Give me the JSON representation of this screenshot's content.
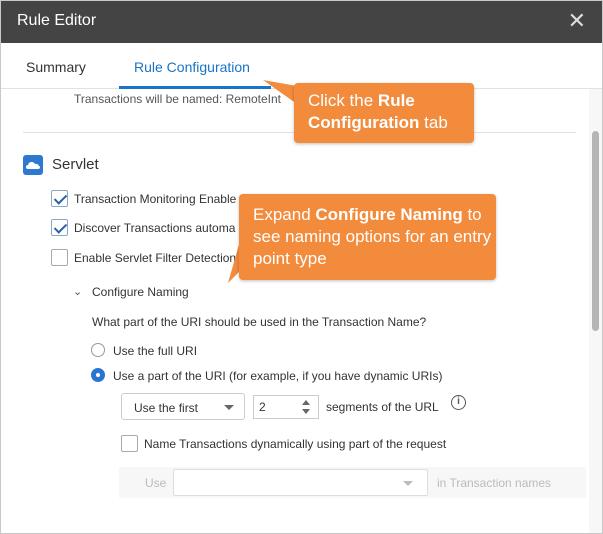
{
  "window": {
    "title": "Rule Editor",
    "close_symbol": "✕"
  },
  "tabs": [
    {
      "label": "Summary"
    },
    {
      "label": "Rule Configuration"
    }
  ],
  "naming_note": "Transactions will be named: RemoteInt",
  "servlet": {
    "heading": "Servlet",
    "options": [
      {
        "label": "Transaction Monitoring Enable",
        "checked": true
      },
      {
        "label": "Discover Transactions automa",
        "checked": true
      },
      {
        "label": "Enable Servlet Filter Detection",
        "checked": false
      }
    ],
    "configure_naming": {
      "label": "Configure Naming",
      "question": "What part of the URI should be used in the Transaction Name?",
      "radios": [
        {
          "label": "Use the full URI",
          "selected": false
        },
        {
          "label": "Use a part of the URI (for example, if you have dynamic URIs)",
          "selected": true
        }
      ],
      "segment_select": "Use the first",
      "segment_count": "2",
      "segment_suffix": "segments of the URL",
      "info_symbol": "i",
      "dynamic_option": {
        "label": "Name Transactions dynamically using part of the request",
        "checked": false
      },
      "use_label": "Use",
      "use_suffix": "in Transaction names"
    }
  },
  "callouts": {
    "tab_hint": {
      "pre": "Click the ",
      "bold": "Rule Configuration",
      "post": " tab"
    },
    "naming_hint": {
      "pre": "Expand ",
      "bold": "Configure Naming",
      "post": " to see naming options for an entry point type"
    }
  },
  "colors": {
    "accent": "#1a73c7",
    "callout": "#f38b3d",
    "titlebar": "#444444"
  }
}
